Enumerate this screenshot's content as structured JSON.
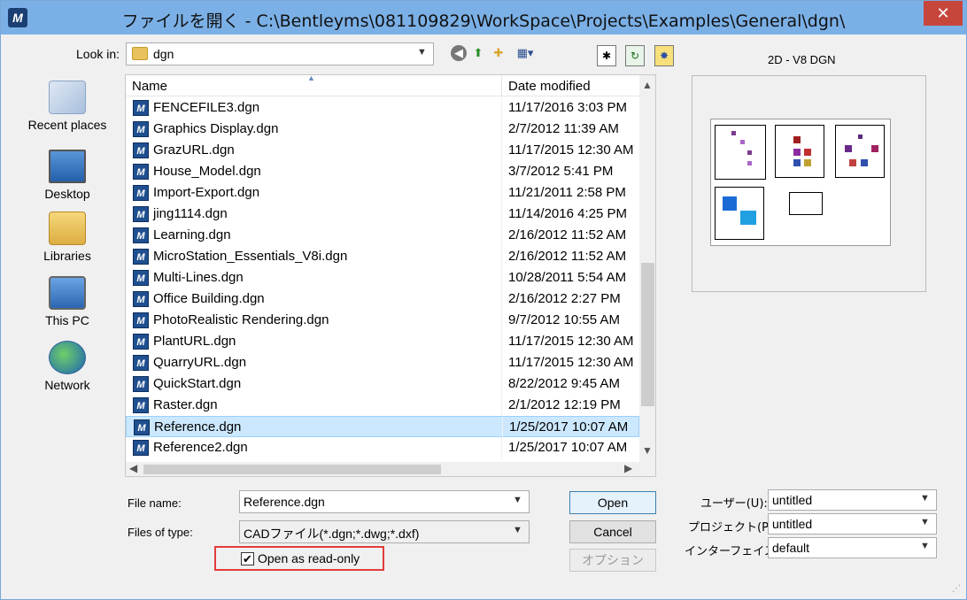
{
  "window": {
    "title": "ファイルを開く - C:\\Bentleyms\\081109829\\WorkSpace\\Projects\\Examples\\General\\dgn\\",
    "app_icon_glyph": "M",
    "close_glyph": "✕"
  },
  "toolbar": {
    "look_in_label": "Look in:",
    "look_in_value": "dgn"
  },
  "places": [
    {
      "label": "Recent places",
      "icon": "recent-places-icon"
    },
    {
      "label": "Desktop",
      "icon": "desktop-icon"
    },
    {
      "label": "Libraries",
      "icon": "libraries-icon"
    },
    {
      "label": "This PC",
      "icon": "this-pc-icon"
    },
    {
      "label": "Network",
      "icon": "network-icon"
    }
  ],
  "filelist": {
    "col_name": "Name",
    "col_date": "Date modified",
    "rows": [
      {
        "name": "FENCEFILE3.dgn",
        "date": "11/17/2016 3:03 PM"
      },
      {
        "name": "Graphics Display.dgn",
        "date": "2/7/2012 11:39 AM"
      },
      {
        "name": "GrazURL.dgn",
        "date": "11/17/2015 12:30 AM"
      },
      {
        "name": "House_Model.dgn",
        "date": "3/7/2012 5:41 PM"
      },
      {
        "name": "Import-Export.dgn",
        "date": "11/21/2011 2:58 PM"
      },
      {
        "name": "jing1114.dgn",
        "date": "11/14/2016 4:25 PM"
      },
      {
        "name": "Learning.dgn",
        "date": "2/16/2012 11:52 AM"
      },
      {
        "name": "MicroStation_Essentials_V8i.dgn",
        "date": "2/16/2012 11:52 AM"
      },
      {
        "name": "Multi-Lines.dgn",
        "date": "10/28/2011 5:54 AM"
      },
      {
        "name": "Office Building.dgn",
        "date": "2/16/2012 2:27 PM"
      },
      {
        "name": "PhotoRealistic Rendering.dgn",
        "date": "9/7/2012 10:55 AM"
      },
      {
        "name": "PlantURL.dgn",
        "date": "11/17/2015 12:30 AM"
      },
      {
        "name": "QuarryURL.dgn",
        "date": "11/17/2015 12:30 AM"
      },
      {
        "name": "QuickStart.dgn",
        "date": "8/22/2012 9:45 AM"
      },
      {
        "name": "Raster.dgn",
        "date": "2/1/2012 12:19 PM"
      },
      {
        "name": "Reference.dgn",
        "date": "1/25/2017 10:07 AM",
        "selected": true
      },
      {
        "name": "Reference2.dgn",
        "date": "1/25/2017 10:07 AM"
      }
    ]
  },
  "preview": {
    "label": "2D - V8 DGN"
  },
  "form": {
    "file_name_label": "File name:",
    "file_name_value": "Reference.dgn",
    "files_of_type_label": "Files of type:",
    "files_of_type_value": "CADファイル(*.dgn;*.dwg;*.dxf)",
    "read_only_label": "Open as read-only",
    "read_only_checked": true
  },
  "buttons": {
    "open": "Open",
    "cancel": "Cancel",
    "options": "オプション"
  },
  "workspace": {
    "user_label": "ユーザー(U):",
    "user_value": "untitled",
    "project_label": "プロジェクト(P):",
    "project_value": "untitled",
    "interface_label": "インターフェイス:",
    "interface_value": "default"
  },
  "colors": {
    "titlebar": "#7bb0e6",
    "selection": "#cce8ff",
    "highlight_box": "#e33b3b",
    "close_button": "#c7463b"
  }
}
